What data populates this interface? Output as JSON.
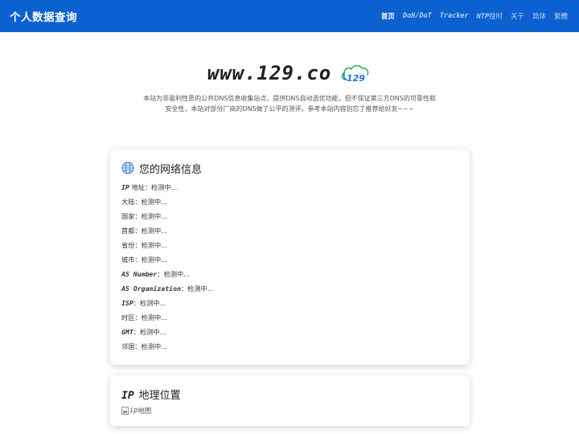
{
  "navbar": {
    "brand": "个人数据查询",
    "links": [
      {
        "label": "首页"
      },
      {
        "label": "DoH/DoT"
      },
      {
        "label": "Tracker"
      },
      {
        "label_mono": "NTP",
        "label_rest": "授时"
      },
      {
        "label": "关于"
      },
      {
        "label": "简体"
      },
      {
        "label": "繁體"
      }
    ]
  },
  "hero": {
    "title": "www.129.co",
    "logo_text": "129",
    "desc_line1": "本站为非盈利性质的公共DNS信息收集站点，提供DNS自动选优功能，但不保证第三方DNS的可靠性和",
    "desc_line2": "安全性，本站对部分厂商的DNS做了公平的测评。参考本站内容别忘了推荐给好友~~~"
  },
  "network_card": {
    "title": "您的网络信息",
    "rows": [
      {
        "key_mono": "IP",
        "key": " 地址",
        "value": "：检测中..."
      },
      {
        "key_mono": "",
        "key": "大陆",
        "value": "：检测中..."
      },
      {
        "key_mono": "",
        "key": "国家",
        "value": "：检测中..."
      },
      {
        "key_mono": "",
        "key": "首都",
        "value": "：检测中..."
      },
      {
        "key_mono": "",
        "key": "省份",
        "value": "：检测中..."
      },
      {
        "key_mono": "",
        "key": "城市",
        "value": "：检测中..."
      },
      {
        "key_mono": "AS Number",
        "key": "",
        "value": "：检测中..."
      },
      {
        "key_mono": "AS Organization",
        "key": "",
        "value": "：检测中..."
      },
      {
        "key_mono": "ISP",
        "key": "",
        "value": "：检测中..."
      },
      {
        "key_mono": "",
        "key": "时区",
        "value": "：检测中..."
      },
      {
        "key_mono": "GMT",
        "key": "",
        "value": "：检测中..."
      },
      {
        "key_mono": "",
        "key": "邻国",
        "value": "：检测中..."
      }
    ]
  },
  "geo_card": {
    "title_mono": "IP",
    "title": "地理位置",
    "image_alt_mono": "ip",
    "image_alt": "地图"
  },
  "colors": {
    "navbar_bg": "#0b61d0",
    "logo_blue": "#1d74d8",
    "logo_green": "#2fb35a"
  }
}
